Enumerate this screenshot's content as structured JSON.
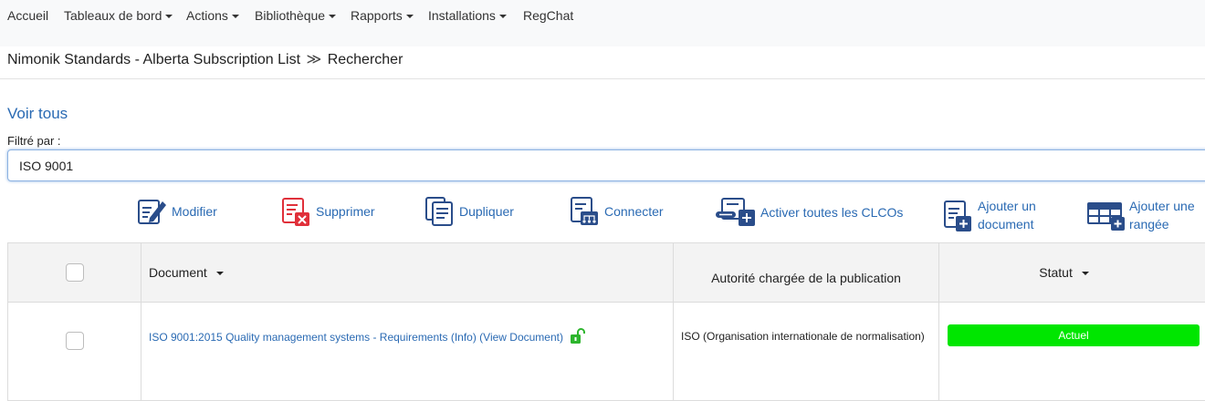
{
  "nav": {
    "items": [
      {
        "label": "Accueil",
        "dropdown": false
      },
      {
        "label": "Tableaux de bord",
        "dropdown": true
      },
      {
        "label": "Actions",
        "dropdown": true
      },
      {
        "label": "Bibliothèque",
        "dropdown": true
      },
      {
        "label": "Rapports",
        "dropdown": true
      },
      {
        "label": "Installations",
        "dropdown": true
      },
      {
        "label": "RegChat",
        "dropdown": false
      }
    ]
  },
  "breadcrumb": {
    "list": "Nimonik Standards - Alberta Subscription List",
    "separator": "≫",
    "current": "Rechercher"
  },
  "view_all": "Voir tous",
  "filter": {
    "label": "Filtré par :",
    "value": "ISO 9001"
  },
  "toolbar": {
    "edit": "Modifier",
    "delete": "Supprimer",
    "duplicate": "Dupliquer",
    "connect": "Connecter",
    "activate_all": "Activer toutes les CLCOs",
    "add_document_line1": "Ajouter un",
    "add_document_line2": "document",
    "add_row_line1": "Ajouter une",
    "add_row_line2": "rangée"
  },
  "table": {
    "headers": {
      "document": "Document",
      "authority": "Autorité chargée de la publication",
      "status": "Statut"
    },
    "rows": [
      {
        "document": "ISO 9001:2015 Quality management systems - Requirements (Info) (View Document)",
        "authority": "ISO (Organisation internationale de normalisation)",
        "status": "Actuel"
      }
    ]
  },
  "colors": {
    "link": "#2a6ab3",
    "status_current": "#00e600",
    "lock_icon": "#2db52d",
    "delete_icon": "#e0303a"
  }
}
